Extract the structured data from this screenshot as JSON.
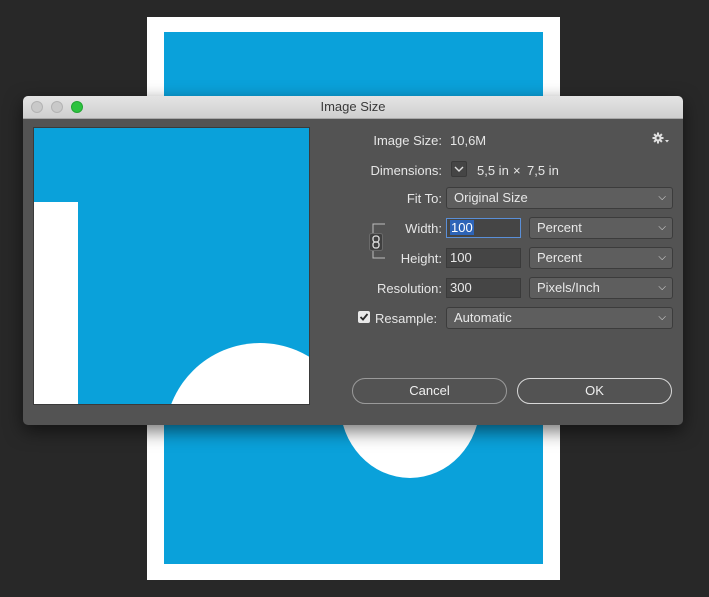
{
  "window": {
    "title": "Image Size"
  },
  "image_size": {
    "label": "Image Size:",
    "value": "10,6M"
  },
  "dimensions": {
    "label": "Dimensions:",
    "width": "5,5 in",
    "separator": "×",
    "height": "7,5 in"
  },
  "fit_to": {
    "label": "Fit To:",
    "value": "Original Size"
  },
  "width": {
    "label": "Width:",
    "value": "100",
    "unit": "Percent"
  },
  "height": {
    "label": "Height:",
    "value": "100",
    "unit": "Percent"
  },
  "resolution": {
    "label": "Resolution:",
    "value": "300",
    "unit": "Pixels/Inch"
  },
  "resample": {
    "label": "Resample:",
    "checked": true,
    "value": "Automatic"
  },
  "buttons": {
    "cancel": "Cancel",
    "ok": "OK"
  },
  "icons": {
    "settings": "gear-icon",
    "link": "chain-link-icon",
    "dropdown": "chevron-down-icon"
  },
  "colors": {
    "canvas_blue": "#0aa1da",
    "dialog_bg": "#535353",
    "selection": "#2d64b8",
    "zoom_green": "#2dc33f"
  }
}
